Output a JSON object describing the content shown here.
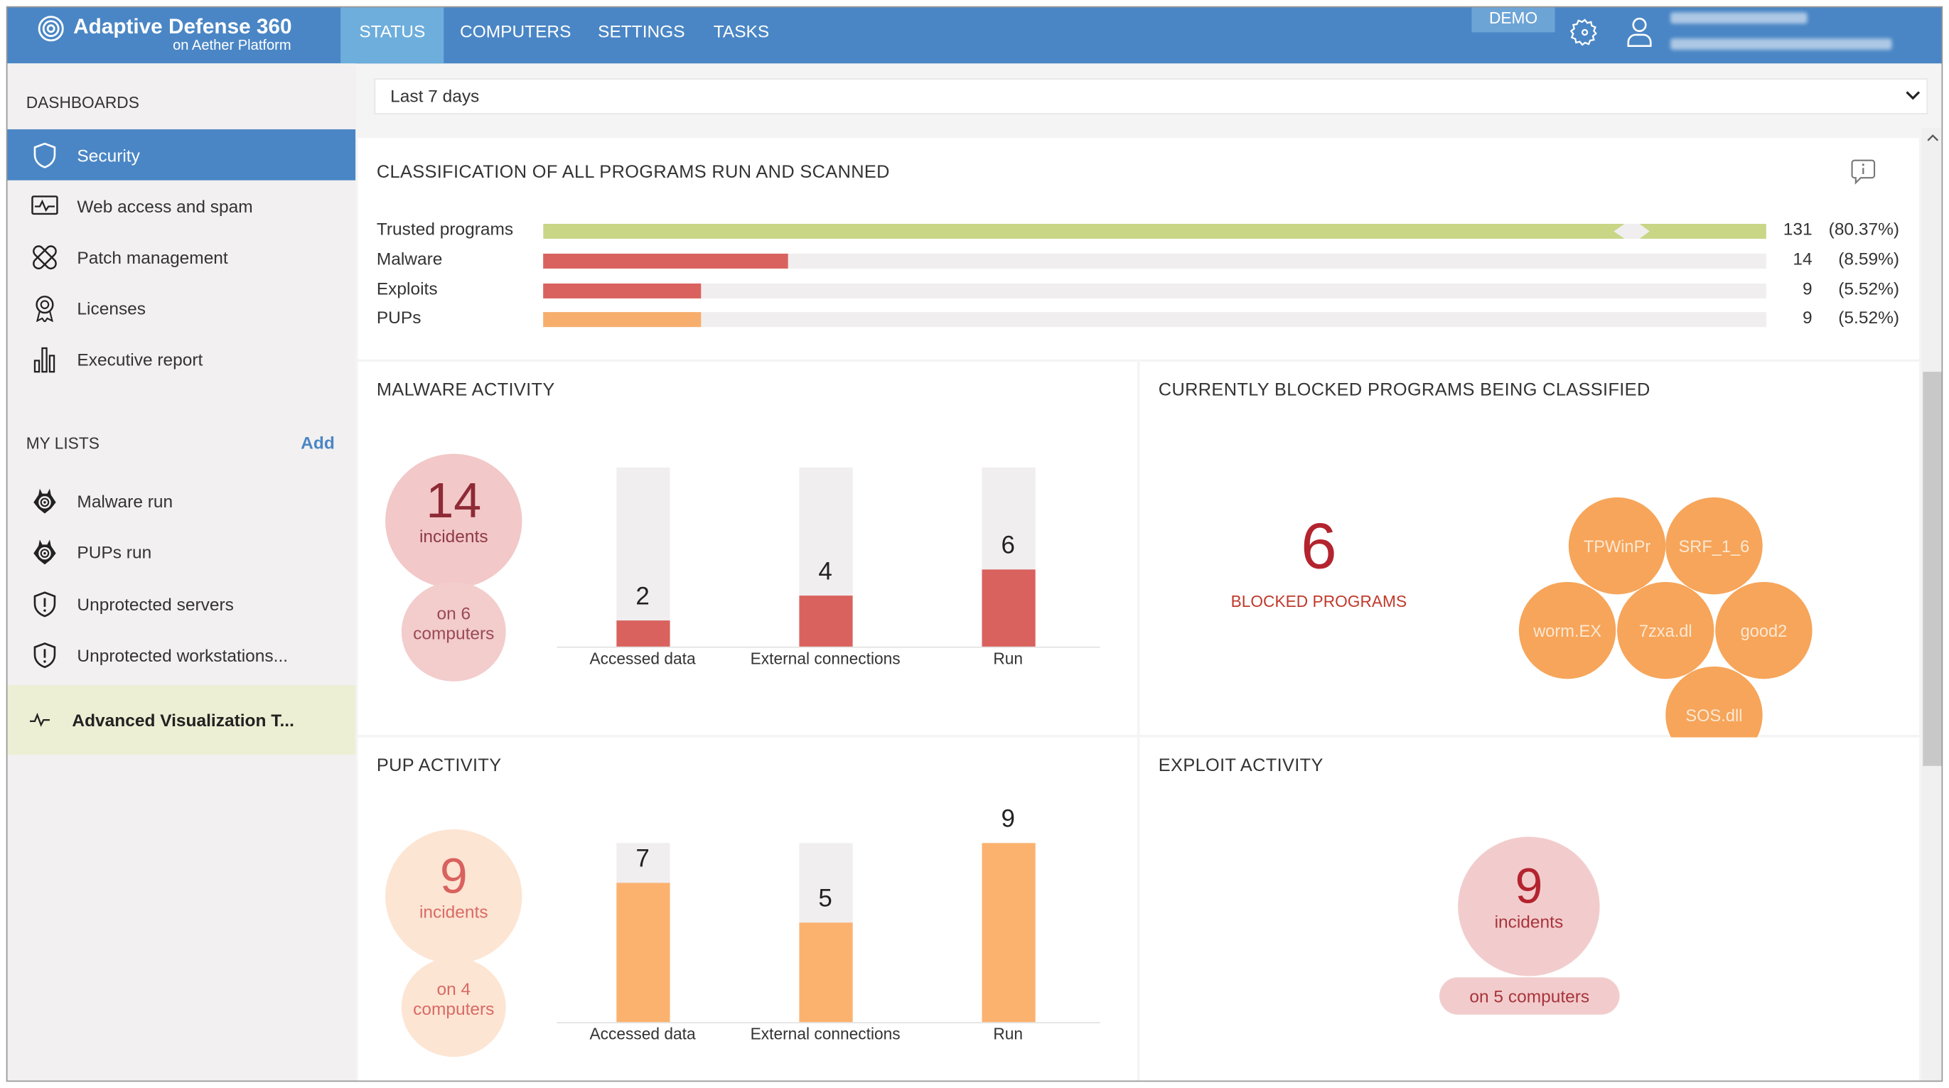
{
  "header": {
    "brand": "Adaptive Defense 360",
    "brand_sub": "on Aether Platform",
    "tabs": [
      {
        "label": "STATUS",
        "active": true
      },
      {
        "label": "COMPUTERS"
      },
      {
        "label": "SETTINGS"
      },
      {
        "label": "TASKS"
      }
    ],
    "demo_badge": "DEMO",
    "icons": [
      "gear-icon",
      "user-icon"
    ],
    "color": "#4a86c5"
  },
  "sidebar": {
    "dashboards_label": "DASHBOARDS",
    "items": [
      {
        "label": "Security",
        "icon": "shield-icon",
        "selected": true
      },
      {
        "label": "Web access and spam",
        "icon": "activity-monitor-icon"
      },
      {
        "label": "Patch management",
        "icon": "patch-icon"
      },
      {
        "label": "Licenses",
        "icon": "award-icon"
      },
      {
        "label": "Executive report",
        "icon": "bar-chart-icon"
      }
    ],
    "my_lists_label": "MY LISTS",
    "add_label": "Add",
    "lists": [
      {
        "label": "Malware run",
        "icon": "malware-icon"
      },
      {
        "label": "PUPs run",
        "icon": "malware-icon"
      },
      {
        "label": "Unprotected servers",
        "icon": "shield-alert-icon"
      },
      {
        "label": "Unprotected workstations...",
        "icon": "shield-alert-icon"
      },
      {
        "label": "Advanced Visualization T...",
        "icon": "pulse-icon",
        "highlighted": true
      }
    ]
  },
  "filter": {
    "period": "Last 7 days"
  },
  "classification": {
    "title": "CLASSIFICATION OF ALL PROGRAMS RUN AND SCANNED",
    "rows": [
      {
        "label": "Trusted programs",
        "count": "131",
        "percent": "(80.37%)",
        "value": 131,
        "color": "#c8d686",
        "broken": true
      },
      {
        "label": "Malware",
        "count": "14",
        "percent": "(8.59%)",
        "value": 14,
        "color": "#d9625e"
      },
      {
        "label": "Exploits",
        "count": "9",
        "percent": "(5.52%)",
        "value": 9,
        "color": "#d9625e"
      },
      {
        "label": "PUPs",
        "count": "9",
        "percent": "(5.52%)",
        "value": 9,
        "color": "#f7ad6b"
      }
    ]
  },
  "malware_activity": {
    "title": "MALWARE ACTIVITY",
    "incidents": "14",
    "incidents_label": "incidents",
    "computers_text": "on 6",
    "computers_label": "computers",
    "total": 14,
    "color": "#d9625e",
    "bars": [
      {
        "label": "Accessed data",
        "value": 2,
        "text": "2"
      },
      {
        "label": "External connections",
        "value": 4,
        "text": "4"
      },
      {
        "label": "Run",
        "value": 6,
        "text": "6"
      }
    ]
  },
  "blocked": {
    "title": "CURRENTLY BLOCKED PROGRAMS BEING CLASSIFIED",
    "count": "6",
    "label": "BLOCKED PROGRAMS",
    "programs": [
      "TPWinPr",
      "SRF_1_6",
      "worm.EX",
      "7zxa.dl",
      "good2",
      "SOS.dll"
    ]
  },
  "pup_activity": {
    "title": "PUP ACTIVITY",
    "incidents": "9",
    "incidents_label": "incidents",
    "computers_text": "on 4",
    "computers_label": "computers",
    "total": 9,
    "color": "#fbb26f",
    "bars": [
      {
        "label": "Accessed data",
        "value": 7,
        "text": "7"
      },
      {
        "label": "External connections",
        "value": 5,
        "text": "5"
      },
      {
        "label": "Run",
        "value": 9,
        "text": "9"
      }
    ]
  },
  "exploit_activity": {
    "title": "EXPLOIT ACTIVITY",
    "incidents": "9",
    "incidents_label": "incidents",
    "computers_text": "on 5 computers"
  }
}
